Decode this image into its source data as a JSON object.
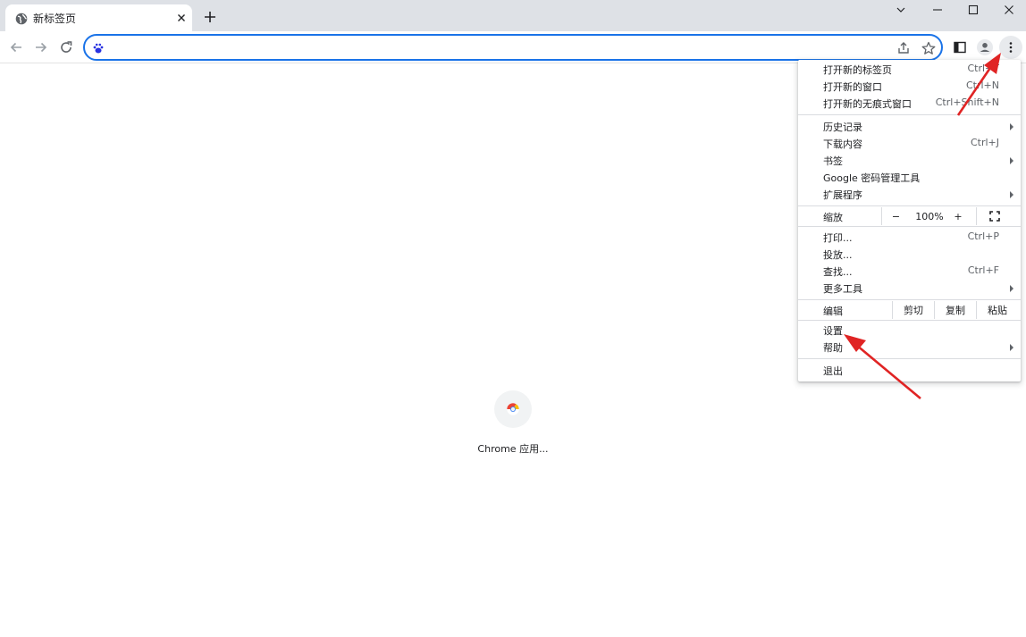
{
  "tab": {
    "title": "新标签页",
    "favicon": "globe-icon",
    "close_icon": "close-icon"
  },
  "window_controls": [
    "chevron-down-icon",
    "minimize-icon",
    "maximize-icon",
    "close-icon"
  ],
  "toolbar": {
    "back_icon": "arrow-left-icon",
    "forward_icon": "arrow-right-icon",
    "reload_icon": "reload-icon",
    "omnibox": {
      "value": "",
      "icon": "baidu-paw-icon"
    },
    "share_icon": "share-icon",
    "bookmark_icon": "star-icon",
    "side_panel_icon": "side-panel-icon",
    "profile_icon": "profile-icon",
    "menu_icon": "kebab-menu-icon"
  },
  "shortcut": {
    "label": "Chrome 应用..."
  },
  "menu": {
    "group1": [
      {
        "label": "打开新的标签页",
        "shortcut": "Ctrl+T"
      },
      {
        "label": "打开新的窗口",
        "shortcut": "Ctrl+N"
      },
      {
        "label": "打开新的无痕式窗口",
        "shortcut": "Ctrl+Shift+N"
      }
    ],
    "group2": [
      {
        "label": "历史记录",
        "shortcut": ""
      },
      {
        "label": "下载内容",
        "shortcut": "Ctrl+J"
      },
      {
        "label": "书签",
        "shortcut": ""
      },
      {
        "label": "Google 密码管理工具",
        "shortcut": ""
      },
      {
        "label": "扩展程序",
        "shortcut": ""
      }
    ],
    "zoom": {
      "label": "缩放",
      "minus": "−",
      "value": "100%",
      "plus": "+"
    },
    "group3": [
      {
        "label": "打印...",
        "shortcut": "Ctrl+P"
      },
      {
        "label": "投放...",
        "shortcut": ""
      },
      {
        "label": "查找...",
        "shortcut": "Ctrl+F"
      },
      {
        "label": "更多工具",
        "shortcut": ""
      }
    ],
    "edit": {
      "label": "编辑",
      "cut": "剪切",
      "copy": "复制",
      "paste": "粘贴"
    },
    "group4": [
      {
        "label": "设置",
        "shortcut": ""
      },
      {
        "label": "帮助",
        "shortcut": ""
      }
    ],
    "exit": {
      "label": "退出"
    }
  },
  "colors": {
    "annotation_arrow": "#e02424",
    "omnibox_focus": "#1a73e8",
    "tabstrip": "#dee1e6"
  }
}
